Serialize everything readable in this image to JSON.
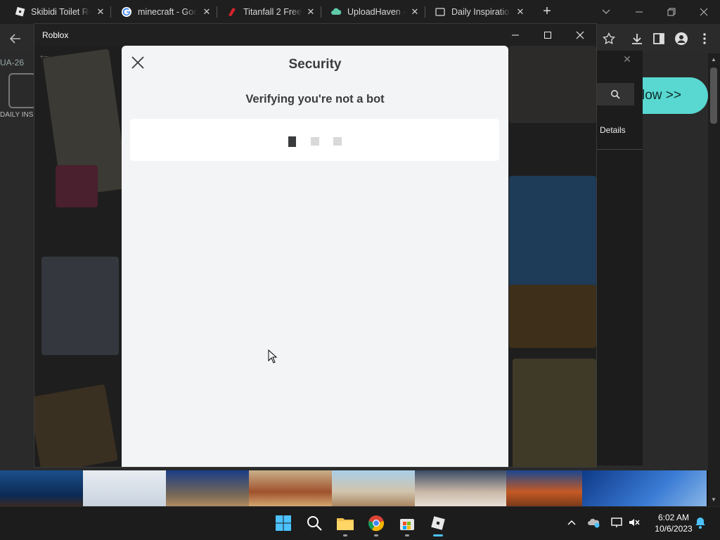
{
  "browser": {
    "tabs": [
      {
        "label": "Skibidi Toilet Ro",
        "icon": "roblox-icon"
      },
      {
        "label": "minecraft - Goo",
        "icon": "google-icon"
      },
      {
        "label": "Titanfall 2 Free",
        "icon": "titanfall-icon"
      },
      {
        "label": "UploadHaven -",
        "icon": "uploadhaven-icon"
      },
      {
        "label": "Daily Inspiration",
        "icon": "daily-inspiration-icon"
      }
    ],
    "new_tab_label": "+",
    "close_glyph": "✕"
  },
  "page": {
    "left_text": "UA-26",
    "logo_text": "DAILY INSI",
    "cta_label": "low >>",
    "details_label": "Details"
  },
  "roblox_window": {
    "title": "Roblox",
    "modal": {
      "title": "Security",
      "subtitle": "Verifying you're not a bot"
    }
  },
  "taskbar": {
    "time": "6:02 AM",
    "date": "10/6/2023"
  },
  "colors": {
    "accent_cta": "#58d8d0",
    "modal_bg": "#f2f4f5",
    "modal_text": "#393b3d",
    "taskbar_active": "#4cc2ff"
  }
}
